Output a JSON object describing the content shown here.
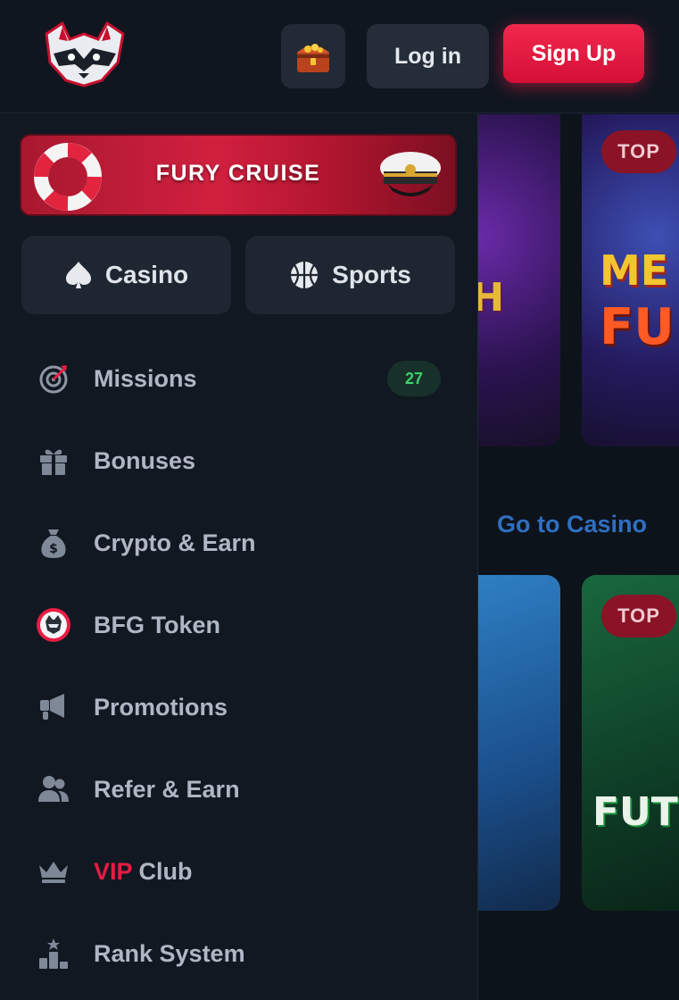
{
  "header": {
    "login_label": "Log in",
    "signup_label": "Sign Up",
    "logo_icon": "raccoon-logo-icon",
    "chest_icon": "treasure-chest-icon"
  },
  "background": {
    "top_badge": "TOP",
    "goto_casino": "Go to Casino",
    "game_art": [
      "CH",
      "ME",
      "FU",
      "E",
      "FUT"
    ]
  },
  "drawer": {
    "promo_banner": {
      "title": "FURY CRUISE"
    },
    "buttons": [
      {
        "label": "Casino",
        "icon": "spade-icon"
      },
      {
        "label": "Sports",
        "icon": "basketball-icon"
      }
    ],
    "menu": [
      {
        "label": "Missions",
        "icon": "target-icon",
        "badge": "27"
      },
      {
        "label": "Bonuses",
        "icon": "gift-icon"
      },
      {
        "label": "Crypto & Earn",
        "icon": "money-bag-icon"
      },
      {
        "label": "BFG Token",
        "icon": "bfg-token-icon"
      },
      {
        "label": "Promotions",
        "icon": "megaphone-icon"
      },
      {
        "label": "Refer & Earn",
        "icon": "users-icon"
      },
      {
        "label_accent": "VIP",
        "label_rest": " Club",
        "icon": "crown-icon"
      },
      {
        "label": "Rank System",
        "icon": "podium-icon"
      }
    ]
  },
  "colors": {
    "accent": "#e81c44",
    "background": "#0f1620",
    "drawer": "#111821",
    "badge_green": "#3cd26a"
  }
}
